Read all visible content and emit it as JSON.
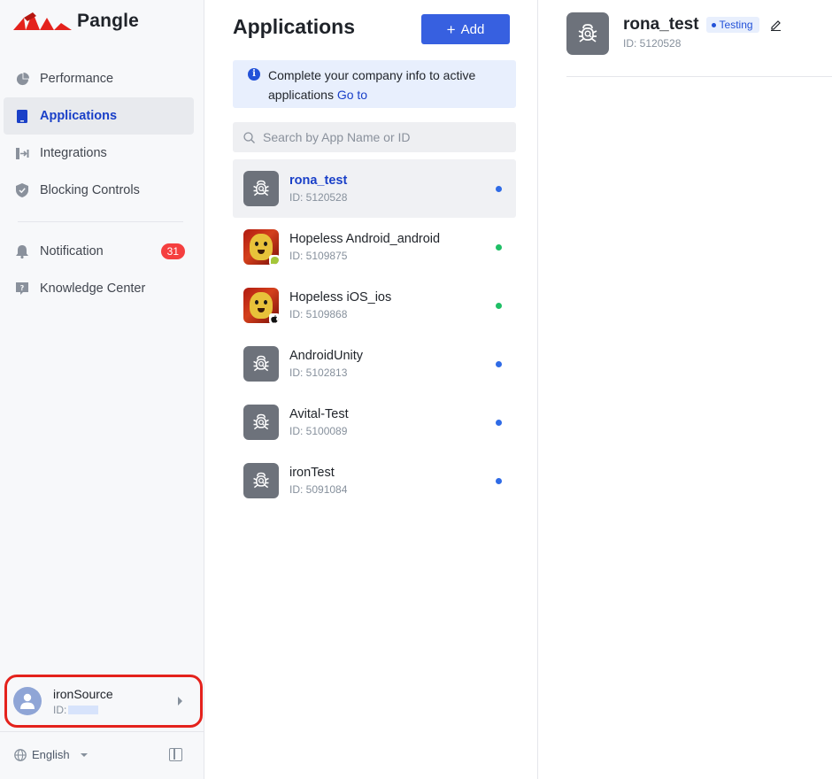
{
  "brand": {
    "name": "Pangle",
    "accent_color": "#e4221c"
  },
  "sidebar": {
    "nav_items": [
      {
        "label": "Performance",
        "icon": "pie-chart-icon",
        "active": false
      },
      {
        "label": "Applications",
        "icon": "mobile-phone-icon",
        "active": true
      },
      {
        "label": "Integrations",
        "icon": "integration-icon",
        "active": false
      },
      {
        "label": "Blocking Controls",
        "icon": "shield-icon",
        "active": false
      }
    ],
    "secondary_items": [
      {
        "label": "Notification",
        "icon": "bell-icon",
        "badge": "31"
      },
      {
        "label": "Knowledge Center",
        "icon": "help-book-icon"
      }
    ],
    "account": {
      "name": "ironSource",
      "id_label": "ID:"
    },
    "language": "English"
  },
  "applications": {
    "title": "Applications",
    "add_label": "Add",
    "notice": {
      "text": "Complete your company info to active applications",
      "link": "Go to"
    },
    "search_placeholder": "Search by App Name or ID",
    "apps": [
      {
        "name": "rona_test",
        "id": "ID: 5120528",
        "icon": "bug-icon",
        "platform": "",
        "status_color": "#2f6be6",
        "selected": true
      },
      {
        "name": "Hopeless Android_android",
        "id": "ID: 5109875",
        "icon": "game-icon",
        "platform": "android-icon",
        "status_color": "#1fbf66",
        "selected": false
      },
      {
        "name": "Hopeless iOS_ios",
        "id": "ID: 5109868",
        "icon": "game-icon",
        "platform": "apple-icon",
        "status_color": "#1fbf66",
        "selected": false
      },
      {
        "name": "AndroidUnity",
        "id": "ID: 5102813",
        "icon": "bug-icon",
        "platform": "",
        "status_color": "#2f6be6",
        "selected": false
      },
      {
        "name": "Avital-Test",
        "id": "ID: 5100089",
        "icon": "bug-icon",
        "platform": "",
        "status_color": "#2f6be6",
        "selected": false
      },
      {
        "name": "ironTest",
        "id": "ID: 5091084",
        "icon": "bug-icon",
        "platform": "",
        "status_color": "#2f6be6",
        "selected": false
      }
    ]
  },
  "detail": {
    "name": "rona_test",
    "status": "Testing",
    "id": "ID: 5120528"
  }
}
